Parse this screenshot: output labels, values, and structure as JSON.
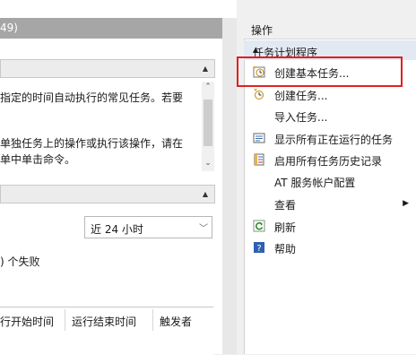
{
  "left": {
    "header_text": "49)",
    "description": [
      "指定的时间自动执行的常见任务。若要",
      "单独任务上的操作或执行该操作，请在",
      "单中单击命令。"
    ],
    "time_filter": {
      "value": "近 24 小时"
    },
    "status_text": ") 个失败",
    "table_headers": [
      "行开始时间",
      "运行结束时间",
      "触发者"
    ]
  },
  "right": {
    "title": "操作",
    "group_label": "任务计划程序",
    "actions": [
      {
        "label": "创建基本任务...",
        "icon": "create-basic-task-icon"
      },
      {
        "label": "创建任务...",
        "icon": "create-task-icon"
      },
      {
        "label": "导入任务...",
        "icon": ""
      },
      {
        "label": "显示所有正在运行的任务",
        "icon": "running-tasks-icon"
      },
      {
        "label": "启用所有任务历史记录",
        "icon": "history-icon"
      },
      {
        "label": "AT 服务帐户配置",
        "icon": ""
      },
      {
        "label": "查看",
        "icon": "",
        "submenu": true
      },
      {
        "label": "刷新",
        "icon": "refresh-icon"
      },
      {
        "label": "帮助",
        "icon": "help-icon"
      }
    ]
  },
  "colors": {
    "highlight": "#e02020",
    "group_header_bg": "#e3e9f3"
  }
}
